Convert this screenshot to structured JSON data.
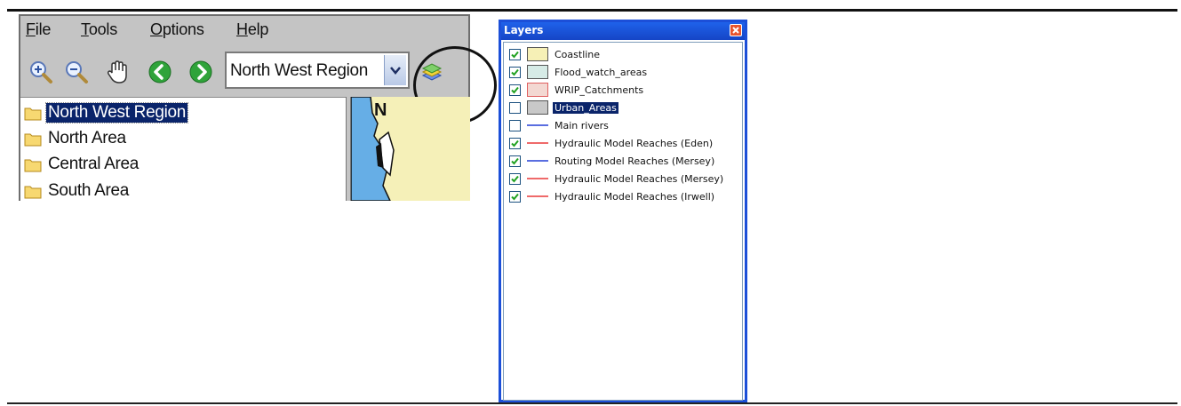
{
  "menu": {
    "items": [
      {
        "mnemonic": "F",
        "rest": "ile"
      },
      {
        "mnemonic": "T",
        "rest": "ools"
      },
      {
        "mnemonic": "O",
        "rest": "ptions"
      },
      {
        "mnemonic": "H",
        "rest": "elp"
      }
    ]
  },
  "toolbar": {
    "icons": [
      "zoom-in-icon",
      "zoom-out-icon",
      "pan-hand-icon",
      "back-arrow-icon",
      "forward-arrow-icon",
      "layers-icon"
    ],
    "region_select": {
      "value": "North West Region"
    }
  },
  "tree": {
    "items": [
      {
        "label": "North West Region",
        "selected": true
      },
      {
        "label": "North Area",
        "selected": false
      },
      {
        "label": "Central Area",
        "selected": false
      },
      {
        "label": "South Area",
        "selected": false
      }
    ]
  },
  "map": {
    "north_label": "N",
    "colors": {
      "land": "#f5f0b8",
      "water": "#66aee6"
    }
  },
  "layers_panel": {
    "title": "Layers",
    "items": [
      {
        "label": "Coastline",
        "checked": true,
        "swatch": "box",
        "color": "#f6f0b6",
        "selected": false
      },
      {
        "label": "Flood_watch_areas",
        "checked": true,
        "swatch": "box",
        "color": "#d6ebe6",
        "selected": false
      },
      {
        "label": "WRIP_Catchments",
        "checked": true,
        "swatch": "box",
        "color": "#f3d8d2",
        "border": "#e06060",
        "selected": false
      },
      {
        "label": "Urban_Areas",
        "checked": false,
        "swatch": "box",
        "color": "#c8c8c8",
        "selected": true
      },
      {
        "label": "Main rivers",
        "checked": false,
        "swatch": "line",
        "color": "#5a6ee0",
        "selected": false
      },
      {
        "label": "Hydraulic Model Reaches (Eden)",
        "checked": true,
        "swatch": "line",
        "color": "#ef6a6a",
        "selected": false
      },
      {
        "label": "Routing Model Reaches (Mersey)",
        "checked": true,
        "swatch": "line",
        "color": "#5a6ee0",
        "selected": false
      },
      {
        "label": "Hydraulic Model Reaches (Mersey)",
        "checked": true,
        "swatch": "line",
        "color": "#ef6a6a",
        "selected": false
      },
      {
        "label": "Hydraulic Model Reaches (Irwell)",
        "checked": true,
        "swatch": "line",
        "color": "#ef6a6a",
        "selected": false
      }
    ]
  }
}
